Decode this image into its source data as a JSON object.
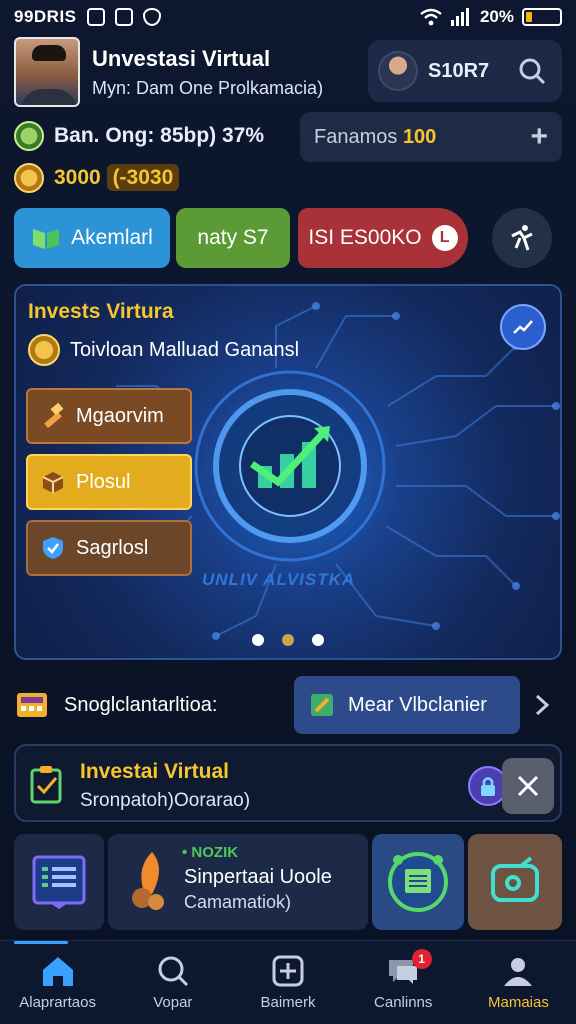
{
  "status_bar": {
    "time": "99DRIS",
    "battery": "20%",
    "battery_level": 0.2
  },
  "profile": {
    "name": "Unvestasi Virtual",
    "subtitle": "Myn: Dam One Prolkamacia)"
  },
  "header_pill": {
    "code": "S10R7"
  },
  "balance": {
    "text": "Ban. Ong: 85bp) 37%",
    "gold_amount": "3000",
    "gold_paren": "(-3030"
  },
  "fav": {
    "label_prefix": "Fanamos ",
    "label_value": "100"
  },
  "actions": {
    "blue": "Akemlarl",
    "green": "naty S7",
    "red": "ISI ES00KO"
  },
  "hero": {
    "title": "Invests Virtura",
    "subtitle": "Toivloan Malluad Ganansl",
    "buttons": [
      "Mgaorvim",
      "Plosul",
      "Sagrlosl"
    ],
    "caption": "UNLIV ALVISTKA"
  },
  "info_row": {
    "label": "Snoglclantarltioa:",
    "more_button": "Mear Vlbclanier"
  },
  "invest_card": {
    "title": "Investai Virtual",
    "subtitle": "Sronpatoh)Oorarao)"
  },
  "tiles": {
    "tag": "NOZIK",
    "title": "Sinpertaai Uoole",
    "subtitle": "Camamatiok)"
  },
  "bottom_nav": {
    "items": [
      "Alaprartaos",
      "Vopar",
      "Baimerk",
      "Canlinns",
      "Mamaias"
    ],
    "badge": "1"
  },
  "colors": {
    "accent_gold": "#f7c52e",
    "accent_blue": "#2b93d6",
    "accent_green": "#5c9a35",
    "accent_red": "#a83238"
  }
}
